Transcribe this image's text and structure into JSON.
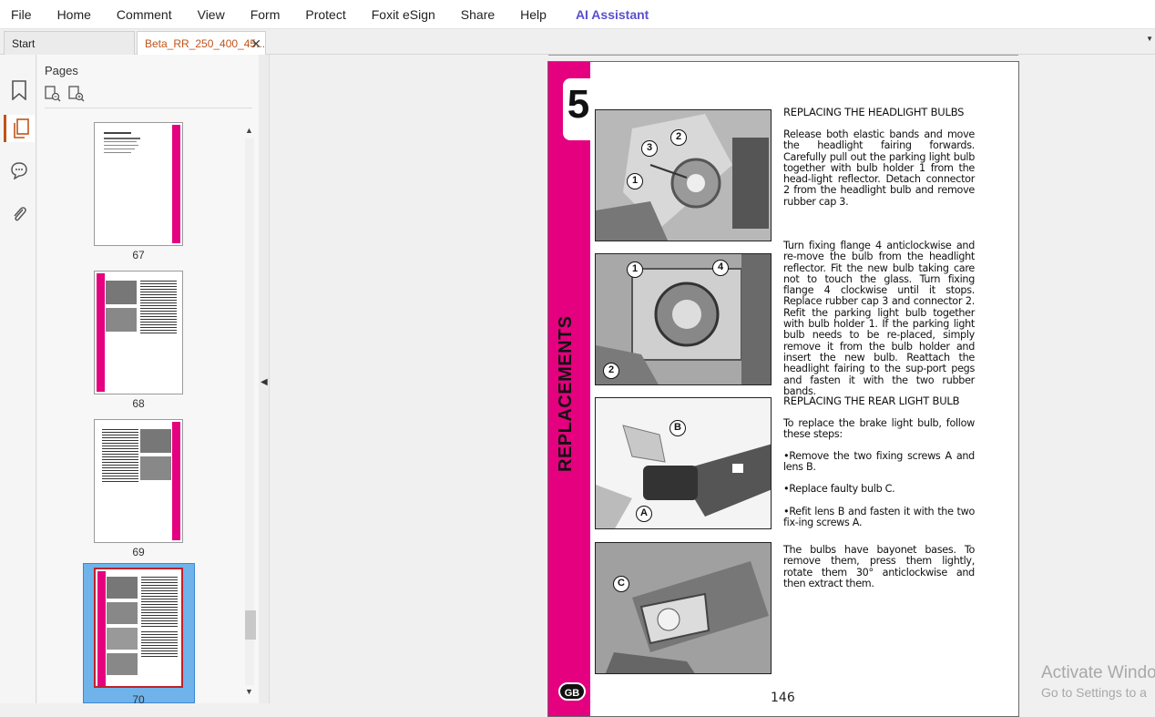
{
  "menu": [
    "File",
    "Home",
    "Comment",
    "View",
    "Form",
    "Protect",
    "Foxit eSign",
    "Share",
    "Help"
  ],
  "ai_assistant": "AI Assistant",
  "tabs": {
    "start": "Start",
    "doc": "Beta_RR_250_400_45..."
  },
  "panel": {
    "title": "Pages"
  },
  "thumbnails": [
    "67",
    "68",
    "69",
    "70"
  ],
  "page": {
    "chapter": "5",
    "section": "REPLACEMENTS",
    "badge": "GB",
    "number": "146",
    "heading1": "REPLACING THE HEADLIGHT BULBS",
    "p1": "Release both elastic bands and move the headlight fairing forwards. Carefully pull out the parking light bulb together with bulb holder 1 from the head-light reflector. Detach connector 2 from the headlight bulb and remove rubber cap 3.",
    "p2": "Turn fixing flange 4 anticlockwise and re-move the bulb from the headlight reflector. Fit the new bulb taking care not to touch the glass. Turn fixing flange 4 clockwise until it stops. Replace rubber cap 3 and connector 2. Refit the parking light bulb together with bulb holder 1. If the parking light bulb needs to be re-placed, simply remove it from the bulb holder and insert the new bulb. Reattach the headlight fairing to the sup-port pegs and fasten it with the two rubber bands.",
    "heading2": "REPLACING THE REAR LIGHT BULB",
    "p3": "To replace the brake light bulb, follow these steps:",
    "b1": "•Remove the two fixing screws A and lens B.",
    "b2": "•Replace faulty bulb C.",
    "b3": "•Refit lens B and fasten it with the two fix-ing screws A.",
    "p4": "The bulbs have bayonet bases. To remove them, press them lightly, rotate them 30° anticlockwise and then extract them.",
    "callouts": [
      "1",
      "2",
      "3",
      "4",
      "A",
      "B",
      "C"
    ]
  },
  "watermark": {
    "line1": "Activate Windo",
    "line2": "Go to Settings to a"
  },
  "colors": {
    "accent": "#e4007e",
    "tab_active": "#c0541a",
    "ai": "#5a4fcf",
    "selection": "#6fb3ea"
  }
}
